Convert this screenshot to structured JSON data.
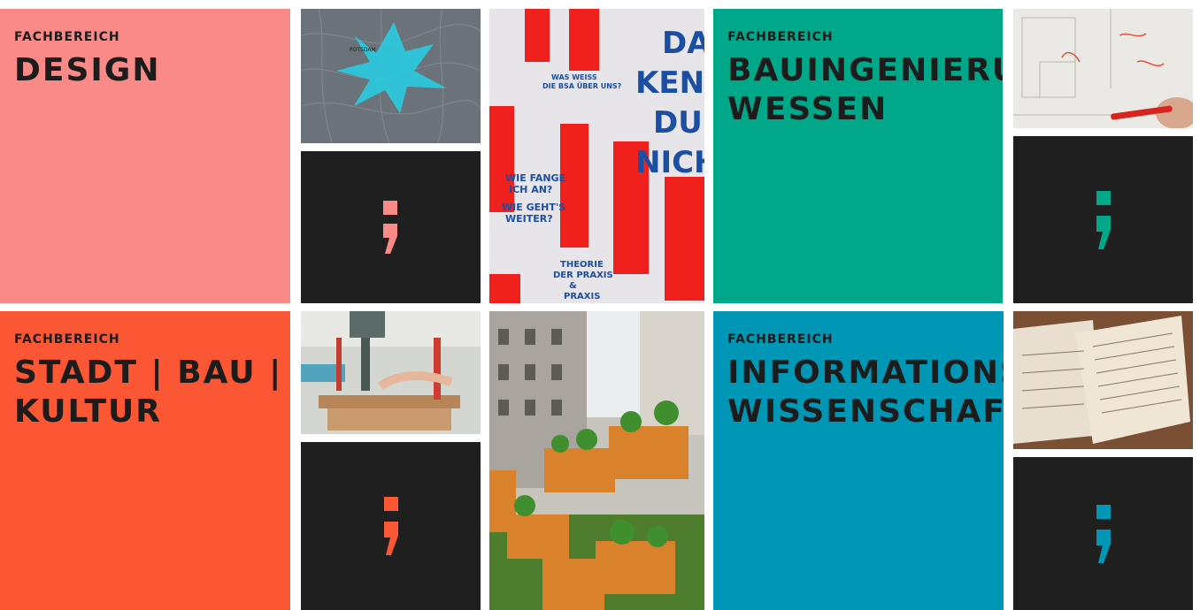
{
  "colors": {
    "design": "#fa8a87",
    "stadt_bau_kultur": "#fb5734",
    "bauingenieurwesen": "#00a789",
    "informationswissenschaften": "#0097b6",
    "dark_tile": "#1f1f1f",
    "text": "#1c1c1c"
  },
  "tiles": {
    "design": {
      "kicker": "FACHBEREICH",
      "title": "DESIGN"
    },
    "stadt_bau_kultur": {
      "kicker": "FACHBEREICH",
      "title": "STADT | BAU |\nKULTUR"
    },
    "bauingenieurwesen": {
      "kicker": "FACHBEREICH",
      "title": "BAUINGENIERU\nWESSEN"
    },
    "informationswissenschaften": {
      "kicker": "FACHBEREICH",
      "title": "INFORMATIONS\nWISSENSCHAFTEN"
    }
  },
  "icons": {
    "semicolon": "semicolon-logo-icon"
  },
  "photos": {
    "map": {
      "label": "POTSDAM"
    },
    "poster": {
      "headline_1": "DA",
      "headline_2": "KENN",
      "headline_3": "DU",
      "headline_4": "NICH",
      "line_1": "WAS WEISS",
      "line_2": "DIE BSA ÜBER UNS?",
      "line_3": "WIE FANGE",
      "line_4": "ICH AN?",
      "line_5": "WIE GEHT'S",
      "line_6": "WEITER?",
      "line_7": "THEORIE",
      "line_8": "DER PRAXIS",
      "line_9": "&",
      "line_10": "PRAXIS"
    }
  }
}
